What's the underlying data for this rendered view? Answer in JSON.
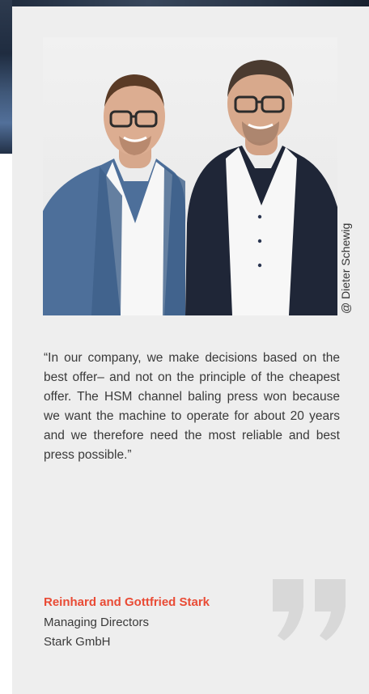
{
  "portrait": {
    "credit": "@ Dieter Schewig"
  },
  "quote": {
    "text": "“In our company, we make decisions based on the best offer– and not on the principle of the cheapest offer. The HSM channel baling press won because we want the machine to operate for about 20 years and we therefore need the most reliable and best press possible.”"
  },
  "author": {
    "name": "Reinhard and Gottfried Stark",
    "role": "Managing Directors",
    "company": "Stark GmbH"
  },
  "colors": {
    "card_background": "#eeeeee",
    "accent": "#e94b35",
    "body_text": "#3a3a3a",
    "quote_mark": "#d8d8d8"
  },
  "icons": {
    "quote_mark": "closing-quotation-mark-icon"
  }
}
